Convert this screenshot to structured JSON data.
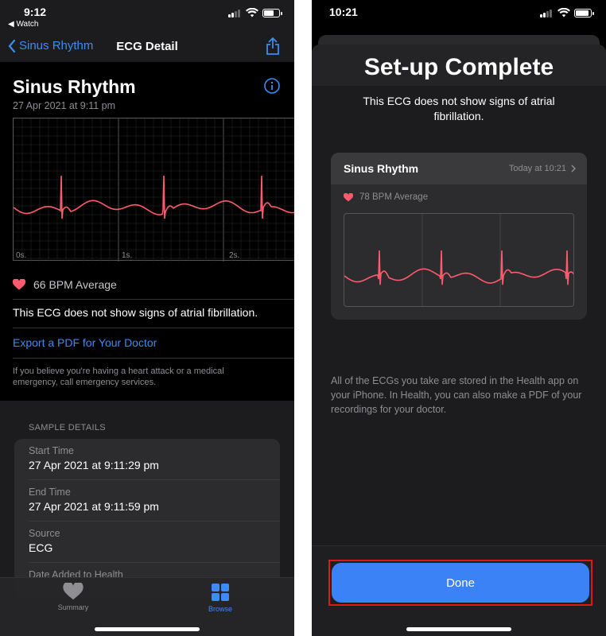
{
  "left": {
    "status": {
      "time": "9:12",
      "back_app": "◀ Watch"
    },
    "nav": {
      "back_label": "Sinus Rhythm",
      "title": "ECG Detail"
    },
    "recording": {
      "title": "Sinus Rhythm",
      "date": "27 Apr 2021 at 9:11 pm",
      "axis_labels": [
        "0s.",
        "1s.",
        "2s."
      ],
      "bpm": "66 BPM Average",
      "result": "This ECG does not show signs of atrial fibrillation.",
      "export_link": "Export a PDF for Your Doctor",
      "emergency": "If you believe you're having a heart attack or a medical emergency, call emergency services."
    },
    "details": {
      "section_title": "SAMPLE DETAILS",
      "rows": [
        {
          "label": "Start Time",
          "value": "27 Apr 2021 at 9:11:29 pm"
        },
        {
          "label": "End Time",
          "value": "27 Apr 2021 at 9:11:59 pm"
        },
        {
          "label": "Source",
          "value": "ECG"
        },
        {
          "label": "Date Added to Health",
          "value": ""
        }
      ]
    },
    "tabs": [
      {
        "label": "Summary",
        "icon": "heart-icon",
        "active": false
      },
      {
        "label": "Browse",
        "icon": "grid-icon",
        "active": true
      }
    ]
  },
  "right": {
    "status": {
      "time": "10:21"
    },
    "title": "Set-up Complete",
    "subtitle": "This ECG does not show signs of atrial fibrillation.",
    "card": {
      "title": "Sinus Rhythm",
      "time": "Today at 10:21",
      "bpm": "78 BPM Average"
    },
    "info": "All of the ECGs you take are stored in the Health app on your iPhone. In Health, you can also make a PDF of your recordings for your doctor.",
    "done_label": "Done"
  },
  "colors": {
    "accent_blue": "#3b8cf5",
    "ecg_red": "#ff5a6e",
    "done_button": "#3b82f6",
    "highlight_red": "#e0161e"
  }
}
